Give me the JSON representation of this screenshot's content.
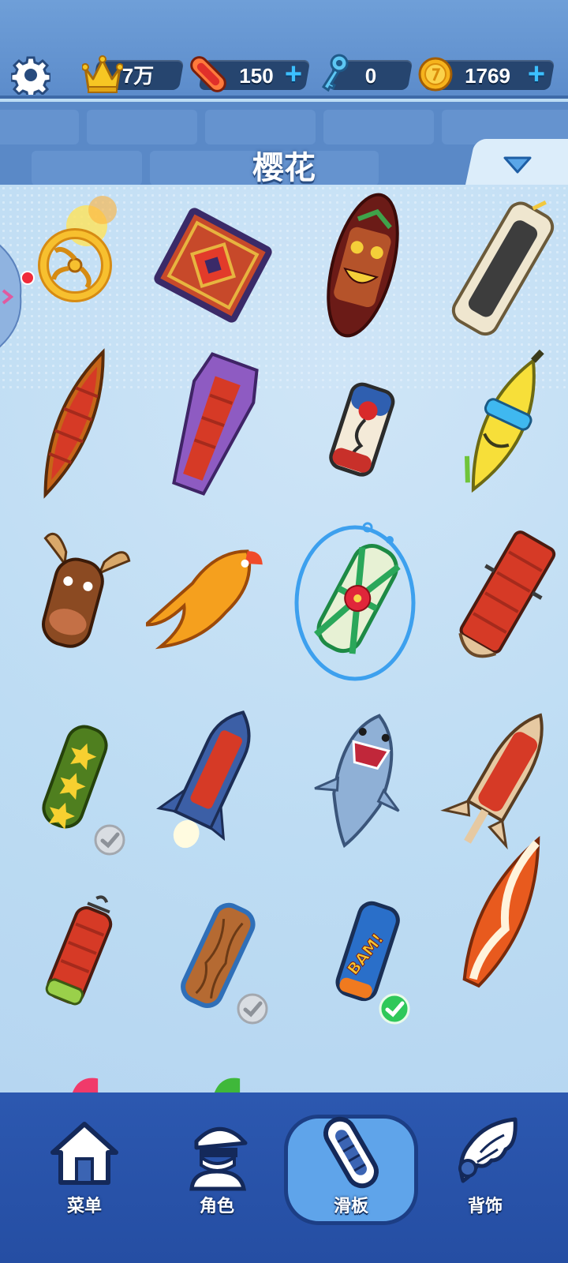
{
  "colors": {
    "top_bar": "#6f9fd8",
    "grid_bg": "#bcdcf4",
    "nav_bg": "#2c58b0",
    "active_tab": "#5fa4ea",
    "selection_ring": "#3da0ee",
    "check_grey": "#c2c6cc",
    "check_green": "#2fc85a"
  },
  "topbar": {
    "settings_icon": "gear-icon",
    "currencies": [
      {
        "name": "crown",
        "icon": "crown-icon",
        "value": "7万",
        "has_plus": false
      },
      {
        "name": "hoverboard",
        "icon": "hoverboard-token-icon",
        "value": "150",
        "has_plus": true
      },
      {
        "name": "key",
        "icon": "key-icon",
        "value": "0",
        "has_plus": false
      },
      {
        "name": "coin",
        "icon": "coin-icon",
        "value": "1769",
        "has_plus": true
      }
    ],
    "plus_label": "+"
  },
  "header": {
    "title": "樱花",
    "dropdown_icon": "triangle-down-icon"
  },
  "boards": [
    {
      "name": "Golden ring board",
      "icon": "golden-ring-board-icon",
      "owned_mark": "none"
    },
    {
      "name": "Magic carpet board",
      "icon": "carpet-board-icon",
      "owned_mark": "none"
    },
    {
      "name": "Tiki mask board",
      "icon": "tiki-board-icon",
      "owned_mark": "none"
    },
    {
      "name": "Bath tub board",
      "icon": "tub-board-icon",
      "owned_mark": "none"
    },
    {
      "name": "Canoe board",
      "icon": "canoe-board-icon",
      "owned_mark": "none"
    },
    {
      "name": "Purple coffin board",
      "icon": "coffin-board-icon",
      "owned_mark": "none"
    },
    {
      "name": "Rose board",
      "icon": "rose-board-icon",
      "owned_mark": "none"
    },
    {
      "name": "Banana board",
      "icon": "banana-board-icon",
      "owned_mark": "none"
    },
    {
      "name": "Moose board",
      "icon": "moose-board-icon",
      "owned_mark": "none"
    },
    {
      "name": "Phoenix board",
      "icon": "phoenix-board-icon",
      "owned_mark": "none"
    },
    {
      "name": "Sakura board",
      "icon": "sakura-board-icon",
      "owned_mark": "selected"
    },
    {
      "name": "Sled board",
      "icon": "sled-board-icon",
      "owned_mark": "none"
    },
    {
      "name": "Star board",
      "icon": "star-board-icon",
      "owned_mark": "owned"
    },
    {
      "name": "Rocket board",
      "icon": "rocket-board-icon",
      "owned_mark": "none"
    },
    {
      "name": "Shark board",
      "icon": "shark-board-icon",
      "owned_mark": "none"
    },
    {
      "name": "Jet board",
      "icon": "jet-board-icon",
      "owned_mark": "none"
    },
    {
      "name": "Scooter board",
      "icon": "scooter-board-icon",
      "owned_mark": "none"
    },
    {
      "name": "Wooden board",
      "icon": "wooden-board-icon",
      "owned_mark": "owned"
    },
    {
      "name": "BAM board",
      "icon": "bam-board-icon",
      "owned_mark": "equipped",
      "label": "BAM!"
    },
    {
      "name": "Surf board",
      "icon": "surf-board-icon",
      "owned_mark": "none"
    }
  ],
  "nav": {
    "tabs": [
      {
        "label": "菜单",
        "icon": "home-icon",
        "active": false
      },
      {
        "label": "角色",
        "icon": "character-icon",
        "active": false
      },
      {
        "label": "滑板",
        "icon": "hoverboard-icon",
        "active": true
      },
      {
        "label": "背饰",
        "icon": "wing-icon",
        "active": false
      }
    ]
  }
}
